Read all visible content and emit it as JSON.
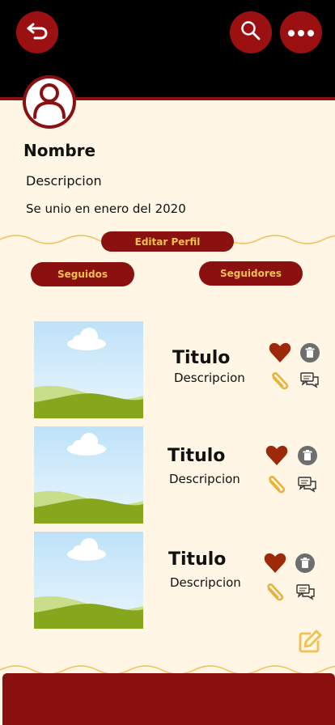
{
  "profile": {
    "name": "Nombre",
    "description": "Descripcion",
    "joined": "Se unio en enero del 2020"
  },
  "actions": {
    "edit_profile": "Editar Perfil",
    "following": "Seguidos",
    "followers": "Seguidores"
  },
  "posts": [
    {
      "title": "Titulo",
      "description": "Descripcion"
    },
    {
      "title": "Titulo",
      "description": "Descripcion"
    },
    {
      "title": "Titulo",
      "description": "Descripcion"
    }
  ],
  "colors": {
    "topbar": "#000000",
    "primary": "#8B1010",
    "accent": "#F1C04F",
    "background": "#FFF6E5",
    "heart": "#9C2A0A"
  },
  "icons": {
    "back": "back-arrow-icon",
    "search": "search-icon",
    "more": "more-dots-icon",
    "like": "heart-icon",
    "delete": "trash-icon",
    "attach": "paperclip-icon",
    "comments": "chat-bubbles-icon",
    "new_post": "edit-icon"
  }
}
